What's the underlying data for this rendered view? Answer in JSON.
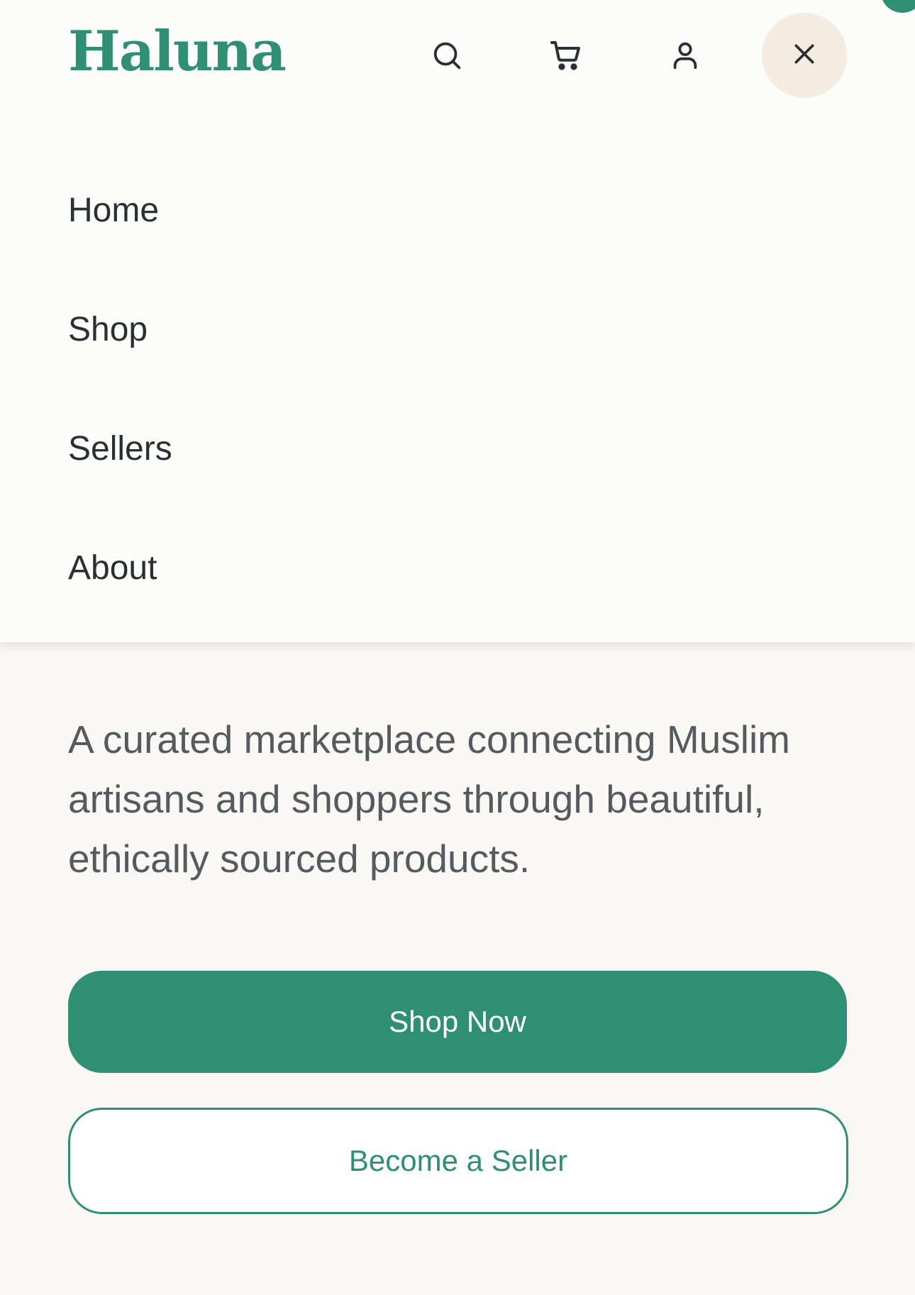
{
  "header": {
    "logo": "Haluna",
    "icons": [
      "search-icon",
      "cart-icon",
      "user-icon",
      "close-icon"
    ]
  },
  "menu": {
    "items": [
      {
        "label": "Home"
      },
      {
        "label": "Shop"
      },
      {
        "label": "Sellers"
      },
      {
        "label": "About"
      }
    ]
  },
  "hero": {
    "description": "A curated marketplace connecting Muslim artisans and shoppers through beautiful, ethically sourced products.",
    "primary_button": "Shop Now",
    "secondary_button": "Become a Seller"
  },
  "colors": {
    "brand": "#2f8f73",
    "close_button_bg": "#f4ece0",
    "text_dark": "#2a2f33",
    "text_muted": "#555a5e",
    "page_bg": "#f9f8f4"
  }
}
